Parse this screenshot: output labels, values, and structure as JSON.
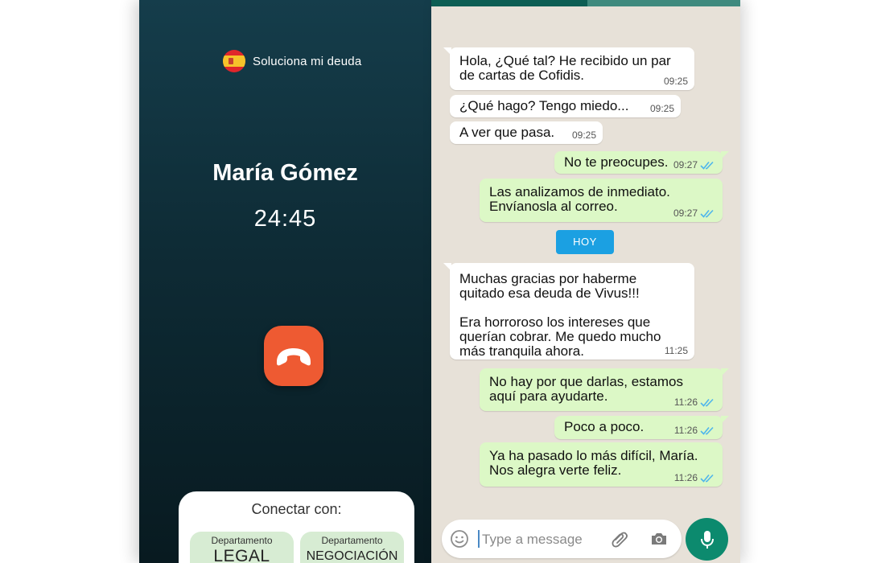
{
  "call": {
    "brand_name": "Soluciona mi deuda",
    "caller_name": "María Gómez",
    "timer": "24:45",
    "connect_title": "Conectar con:",
    "departments": [
      {
        "label": "Departamento",
        "name": "LEGAL"
      },
      {
        "label": "Departamento",
        "name": "NEGOCIACIÓN"
      }
    ]
  },
  "chat": {
    "messages": [
      {
        "direction": "in",
        "text": "Hola, ¿Qué tal? He recibido un par\nde cartas de Cofidis.",
        "time": "09:25"
      },
      {
        "direction": "in",
        "text": "¿Qué hago? Tengo miedo...",
        "time": "09:25"
      },
      {
        "direction": "in",
        "text": "A ver que pasa.",
        "time": "09:25"
      },
      {
        "direction": "out",
        "text": "No te preocupes.",
        "time": "09:27"
      },
      {
        "direction": "out",
        "text": "Las analizamos de inmediato.\nEnvíanosla al correo.",
        "time": "09:27"
      },
      {
        "direction": "in",
        "text": "Muchas gracias por haberme\nquitado esa deuda de Vivus!!!\n\nEra horroroso los intereses que\nquerían cobrar. Me quedo mucho\nmás tranquila ahora.",
        "time": "11:25"
      },
      {
        "direction": "out",
        "text": "No hay por que darlas, estamos\naquí para ayudarte.",
        "time": "11:26"
      },
      {
        "direction": "out",
        "text": "Poco a poco.",
        "time": "11:26"
      },
      {
        "direction": "out",
        "text": "Ya ha pasado lo más difícil, María.\nNos alegra verte feliz.",
        "time": "11:26"
      }
    ],
    "day_divider": "HOY",
    "composer_placeholder": "Type a message"
  },
  "colors": {
    "call_bg_top": "#153d4b",
    "call_bg_bottom": "#081a20",
    "hangup": "#ee5a32",
    "chat_bg": "#e7e1d8",
    "bubble_out": "#dcf8c6",
    "bubble_in": "#ffffff",
    "day_chip": "#1ba0e2",
    "mic_button": "#0c8a6e",
    "read_ticks": "#4fb6ec"
  },
  "icons": {
    "flag": "spain-flag-icon",
    "hangup": "phone-hangup-icon",
    "emoji": "emoji-icon",
    "attach": "paperclip-icon",
    "camera": "camera-icon",
    "mic": "microphone-icon",
    "ticks": "double-check-icon"
  }
}
